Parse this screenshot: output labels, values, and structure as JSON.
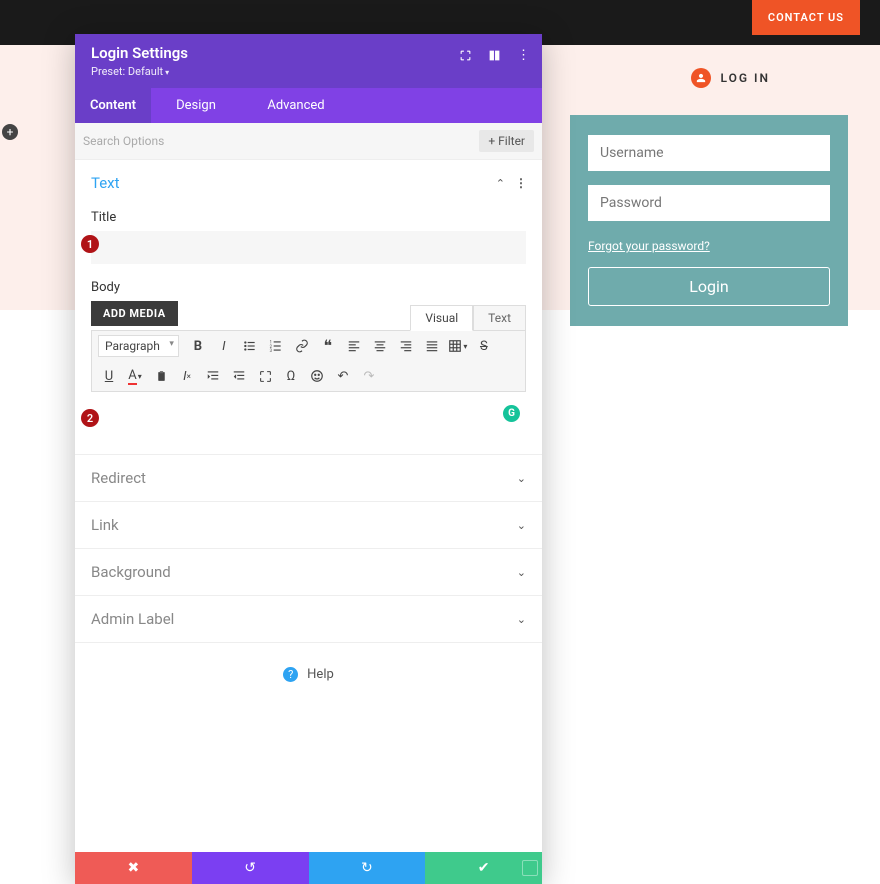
{
  "topbar": {
    "contact": "CONTACT US"
  },
  "loginTop": {
    "label": "LOG IN"
  },
  "loginBox": {
    "username_ph": "Username",
    "password_ph": "Password",
    "forgot": "Forgot your password?",
    "button": "Login"
  },
  "panel": {
    "title": "Login Settings",
    "preset": "Preset: Default",
    "tabs": {
      "content": "Content",
      "design": "Design",
      "advanced": "Advanced"
    },
    "search_ph": "Search Options",
    "filter": "Filter",
    "sections": {
      "text": "Text",
      "redirect": "Redirect",
      "link": "Link",
      "background": "Background",
      "adminLabel": "Admin Label"
    },
    "text": {
      "titleLabel": "Title",
      "bodyLabel": "Body",
      "addMedia": "ADD MEDIA",
      "editorTabs": {
        "visual": "Visual",
        "text": "Text"
      },
      "paragraph": "Paragraph"
    },
    "help": "Help",
    "badges": {
      "one": "1",
      "two": "2"
    }
  }
}
